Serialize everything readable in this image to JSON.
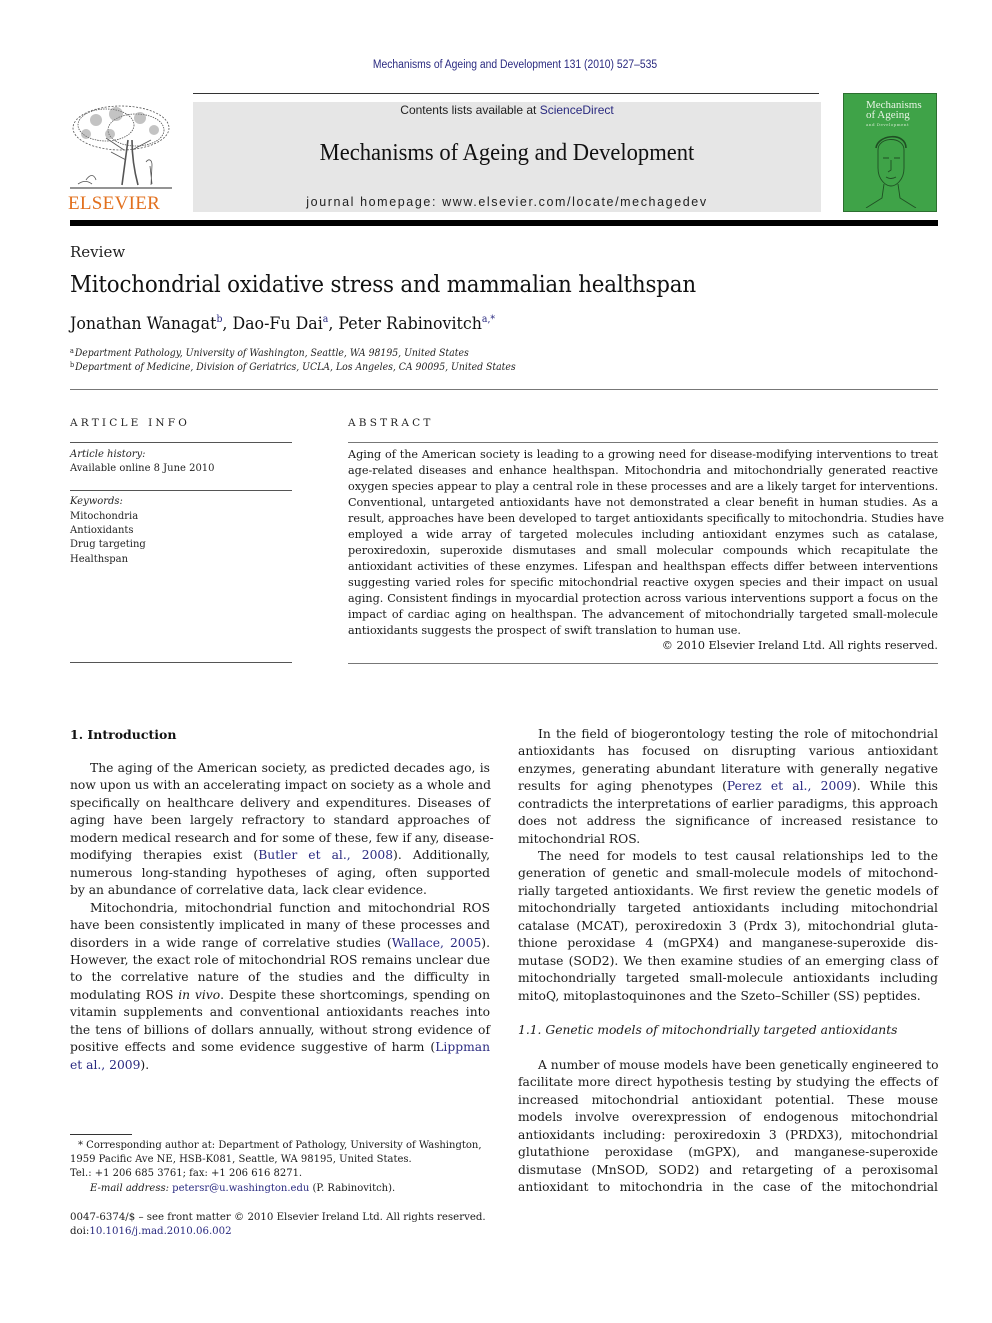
{
  "header": {
    "citation": "Mechanisms of Ageing and Development 131 (2010) 527–535",
    "publisher_logo_text": "ELSEVIER",
    "contents_prefix": "Contents lists available at ",
    "contents_link": "ScienceDirect",
    "journal_name": "Mechanisms of Ageing and Development",
    "homepage": "journal homepage: www.elsevier.com/locate/mechagedev",
    "cover_title_line1": "Mechanisms",
    "cover_title_line2": "of Ageing",
    "cover_subtitle": "and Development",
    "colors": {
      "logo_orange": "#e2701e",
      "link_blue": "#2a2a80",
      "cover_green": "#3fa348",
      "masthead_gray": "#e6e6e6"
    }
  },
  "article": {
    "type": "Review",
    "title": "Mitochondrial oxidative stress and mammalian healthspan",
    "authors": [
      {
        "name": "Jonathan Wanagat",
        "sup": "b"
      },
      {
        "name": "Dao-Fu Dai",
        "sup": "a"
      },
      {
        "name": "Peter Rabinovitch",
        "sup": "a,*"
      }
    ],
    "affiliations": [
      {
        "mark": "a",
        "text": "Department Pathology, University of Washington, Seattle, WA 98195, United States"
      },
      {
        "mark": "b",
        "text": "Department of Medicine, Division of Geriatrics, UCLA, Los Angeles, CA 90095, United States"
      }
    ]
  },
  "article_info": {
    "heading": "ARTICLE INFO",
    "history_label": "Article history:",
    "history_value": "Available online 8 June 2010",
    "keywords_label": "Keywords:",
    "keywords": [
      "Mitochondria",
      "Antioxidants",
      "Drug targeting",
      "Healthspan"
    ]
  },
  "abstract": {
    "heading": "ABSTRACT",
    "lines": [
      "Aging of the American society is leading to a growing need for disease-modifying interventions to treat",
      "age-related diseases and enhance healthspan. Mitochondria and mitochondrially generated reactive",
      "oxygen species appear to play a central role in these processes and are a likely target for interventions.",
      "Conventional, untargeted antioxidants have not demonstrated a clear benefit in human studies. As a",
      "result, approaches have been developed to target antioxidants specifically to mitochondria. Studies have",
      "employed a wide array of targeted molecules including antioxidant enzymes such as catalase,",
      "peroxiredoxin, superoxide dismutases and small molecular compounds which recapitulate the",
      "antioxidant activities of these enzymes. Lifespan and healthspan effects differ between interventions",
      "suggesting varied roles for specific mitochondrial reactive oxygen species and their impact on usual",
      "aging. Consistent findings in myocardial protection across various interventions support a focus on the",
      "impact of cardiac aging on healthspan. The advancement of mitochondrially targeted small-molecule",
      "antioxidants suggests the prospect of swift translation to human use."
    ],
    "copyright": "© 2010 Elsevier Ireland Ltd. All rights reserved."
  },
  "body": {
    "intro_heading": "1.  Introduction",
    "left_p1": [
      "The aging of the American society, as predicted decades ago, is",
      "now upon us with an accelerating impact on society as a whole and",
      "specifically on healthcare delivery and expenditures. Diseases of",
      "aging have been largely refractory to standard approaches of",
      "modern medical research and for some of these, few if any, disease-",
      [
        "modifying therapies exist (",
        "Butler et al., 2008",
        "). Additionally,"
      ],
      "numerous long-standing hypotheses of aging, often supported",
      "by an abundance of correlative data, lack clear evidence."
    ],
    "left_p2": [
      "Mitochondria, mitochondrial function and mitochondrial ROS",
      "have been consistently implicated in many of these processes and",
      [
        "disorders in a wide range of correlative studies (",
        "Wallace, 2005",
        ")."
      ],
      "However, the exact role of mitochondrial ROS remains unclear due",
      "to the correlative nature of the studies and the difficulty in",
      [
        "modulating ROS ",
        "in vivo",
        ". Despite these shortcomings, spending on"
      ],
      "vitamin supplements and conventional antioxidants reaches into",
      "the tens of billions of dollars annually, without strong evidence of",
      [
        "positive effects and some evidence suggestive of harm (",
        "Lippman",
        ""
      ],
      [
        "",
        "et al., 2009",
        ")."
      ]
    ],
    "right_p1": [
      "In the field of biogerontology testing the role of mitochondrial",
      "antioxidants has focused on disrupting various antioxidant",
      "enzymes, generating abundant literature with generally negative",
      [
        "results for aging phenotypes (",
        "Perez et al., 2009",
        "). While this"
      ],
      "contradicts the interpretations of earlier paradigms, this approach",
      "does not address the significance of increased resistance to",
      "mitochondrial ROS."
    ],
    "right_p2": [
      "The need for models to test causal relationships led to the",
      "generation of genetic and small-molecule models of mitochond-",
      "rially targeted antioxidants. We first review the genetic models of",
      "mitochondrially targeted antioxidants including mitochondrial",
      "catalase (MCAT), peroxiredoxin 3 (Prdx 3), mitochondrial gluta-",
      "thione peroxidase 4 (mGPX4) and manganese-superoxide dis-",
      "mutase (SOD2). We then examine studies of an emerging class of",
      "mitochondrially targeted small-molecule antioxidants including",
      "mitoQ, mitoplastoquinones and the Szeto–Schiller (SS) peptides."
    ],
    "subsection_heading": "1.1.  Genetic models of mitochondrially targeted antioxidants",
    "right_p3": [
      "A number of mouse models have been genetically engineered to",
      "facilitate more direct hypothesis testing by studying the effects of",
      "increased mitochondrial antioxidant potential. These mouse",
      "models involve overexpression of endogenous mitochondrial",
      "antioxidants including: peroxiredoxin 3 (PRDX3), mitochondrial",
      "glutathione peroxidase (mGPX), and manganese-superoxide",
      "dismutase (MnSOD, SOD2) and retargeting of a peroxisomal",
      "antioxidant to mitochondria in the case of the mitochondrial"
    ]
  },
  "footnote": {
    "line1": "* Corresponding author at: Department of Pathology, University of Washington,",
    "line2": "1959 Pacific Ave NE, HSB-K081, Seattle, WA 98195, United States.",
    "line3": "Tel.: +1 206 685 3761; fax: +1 206 616 8271.",
    "email_label": "E-mail address: ",
    "email": "petersr@u.washington.edu",
    "email_suffix": " (P. Rabinovitch)."
  },
  "footer": {
    "issn_line": "0047-6374/$ – see front matter © 2010 Elsevier Ireland Ltd. All rights reserved.",
    "doi_prefix": "doi:",
    "doi": "10.1016/j.mad.2010.06.002"
  }
}
